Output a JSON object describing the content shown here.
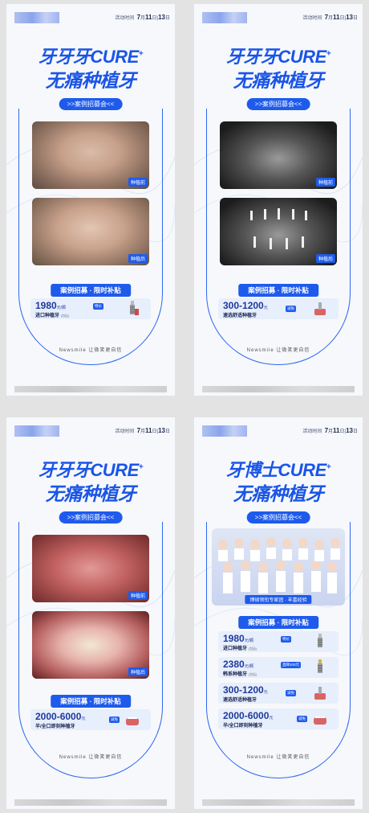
{
  "posters": [
    {
      "time_label": "活动时间",
      "time_month": "7",
      "time_month_unit": "月",
      "time_day1": "11",
      "time_day_unit": "日",
      "time_day2": "13",
      "time_day_unit2": "日",
      "title_line1": "牙牙牙CURE",
      "title_plus": "+",
      "title_line2": "无痛种植牙",
      "subtitle": ">>案例招募会<<",
      "photo1_tag": "种植前",
      "photo2_tag": "种植后",
      "banner": "案例招募 · 限时补贴",
      "offers": [
        {
          "price": "1980",
          "unit": "元/颗",
          "tag": "特价",
          "name": "进口种植牙",
          "note": "(包括)"
        }
      ],
      "footer": "Newsmile  让微笑更自信"
    },
    {
      "time_label": "活动时间",
      "time_month": "7",
      "time_month_unit": "月",
      "time_day1": "11",
      "time_day_unit": "日",
      "time_day2": "13",
      "time_day_unit2": "日",
      "title_line1": "牙牙牙CURE",
      "title_plus": "+",
      "title_line2": "无痛种植牙",
      "subtitle": ">>案例招募会<<",
      "photo1_tag": "种植前",
      "photo2_tag": "种植后",
      "banner": "案例招募 · 限时补贴",
      "offers": [
        {
          "price": "300-1200",
          "unit": "元",
          "tag": "减免",
          "name": "速选舒适种植牙",
          "note": ""
        }
      ],
      "footer": "Newsmile  让微笑更自信"
    },
    {
      "time_label": "活动时间",
      "time_month": "7",
      "time_month_unit": "月",
      "time_day1": "11",
      "time_day_unit": "日",
      "time_day2": "13",
      "time_day_unit2": "日",
      "title_line1": "牙牙牙CURE",
      "title_plus": "+",
      "title_line2": "无痛种植牙",
      "subtitle": ">>案例招募会<<",
      "photo1_tag": "种植前",
      "photo2_tag": "种植后",
      "banner": "案例招募 · 限时补贴",
      "offers": [
        {
          "price": "2000-6000",
          "unit": "元",
          "tag": "减免",
          "name": "半/全口即刻种植牙",
          "note": ""
        }
      ],
      "footer": "Newsmile  让微笑更自信"
    },
    {
      "time_label": "活动时间",
      "time_month": "7",
      "time_month_unit": "月",
      "time_day1": "11",
      "time_day_unit": "日",
      "time_day2": "13",
      "time_day_unit2": "日",
      "title_line1": "牙博士CURE",
      "title_plus": "+",
      "title_line2": "无痛种植牙",
      "subtitle": ">>案例招募会<<",
      "team_tag": "博硕领衔专家团 · 丰富经验",
      "banner": "案例招募 · 限时补贴",
      "offers": [
        {
          "price": "1980",
          "unit": "元/颗",
          "tag": "特价",
          "name": "进口种植牙",
          "note": "(包括)"
        },
        {
          "price": "2380",
          "unit": "元/颗",
          "tag": "直降200元",
          "name": "韩系种植牙",
          "note": "(包括)"
        },
        {
          "price": "300-1200",
          "unit": "元",
          "tag": "减免",
          "name": "速选舒适种植牙",
          "note": ""
        },
        {
          "price": "2000-6000",
          "unit": "元",
          "tag": "减免",
          "name": "半/全口即刻种植牙",
          "note": ""
        }
      ],
      "footer": "Newsmile  让微笑更自信"
    }
  ],
  "colors": {
    "brand_blue": "#1e5bec",
    "title_blue": "#1a55e6",
    "card_bg": "#e7eefc",
    "page_bg": "#e3e3e3"
  },
  "icons": [
    "implant-screw-icon",
    "denture-model-icon"
  ]
}
